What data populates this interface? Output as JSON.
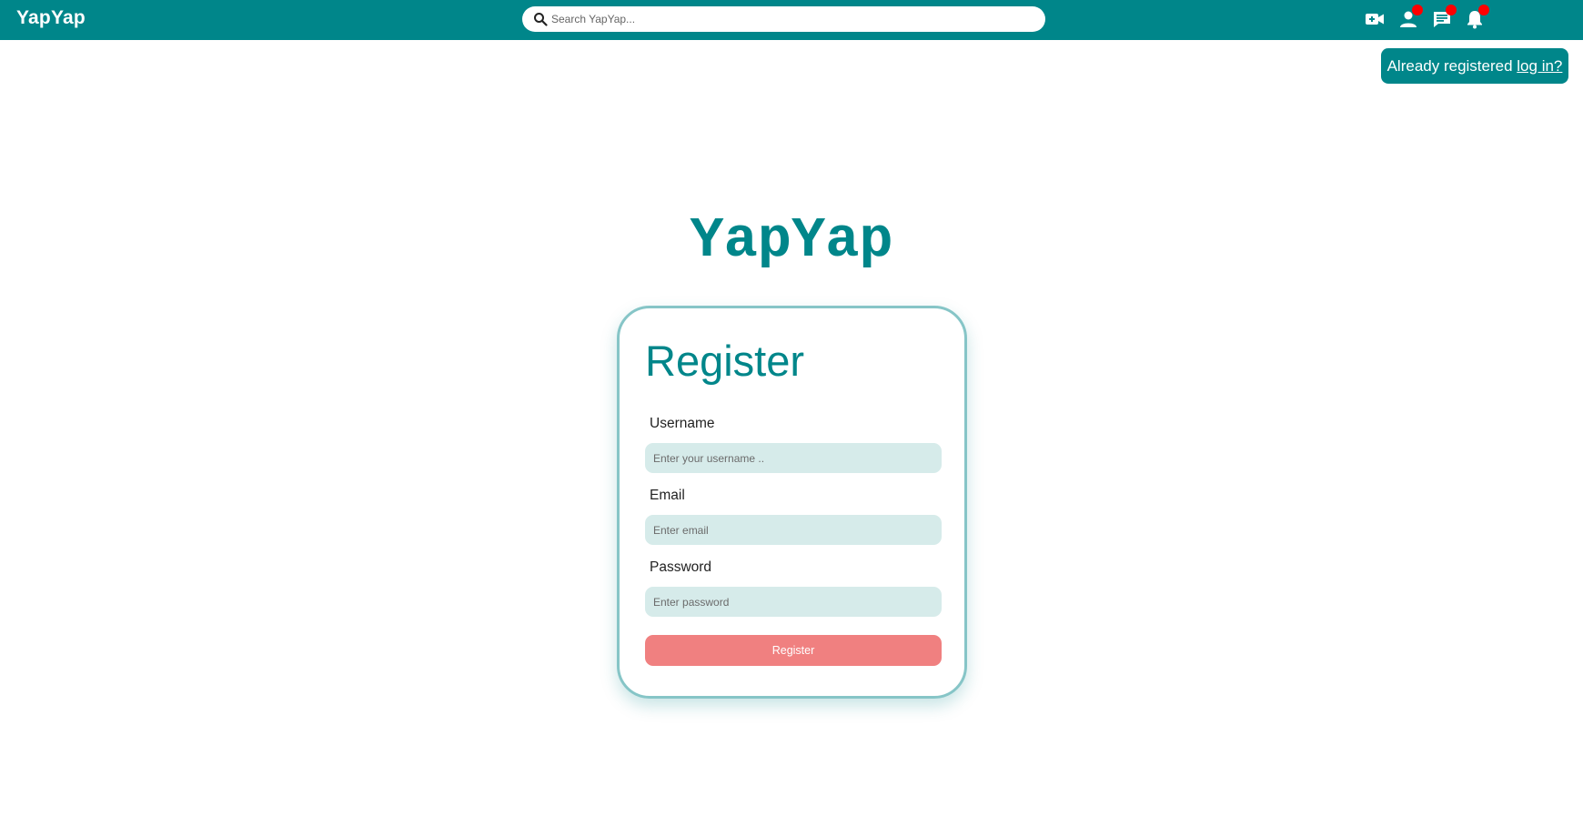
{
  "app": {
    "brand": "YapYap"
  },
  "header": {
    "search_placeholder": "Search YapYap...",
    "icons": [
      {
        "name": "video-call-icon",
        "badge": false
      },
      {
        "name": "person-icon",
        "badge": true
      },
      {
        "name": "chat-icon",
        "badge": true
      },
      {
        "name": "bell-icon",
        "badge": true
      }
    ],
    "badge_color": "#ff0000"
  },
  "login_prompt": {
    "text": "Already registered ",
    "link": "log in?"
  },
  "logo": "YapYap",
  "form": {
    "title": "Register",
    "username_label": "Username",
    "username_placeholder": "Enter your username ..",
    "email_label": "Email",
    "email_placeholder": "Enter email",
    "password_label": "Password",
    "password_placeholder": "Enter password",
    "submit_label": "Register"
  },
  "colors": {
    "primary": "#00868a",
    "input_bg": "#d6ebea",
    "button": "#f08080",
    "card_border": "#86c5c7"
  }
}
